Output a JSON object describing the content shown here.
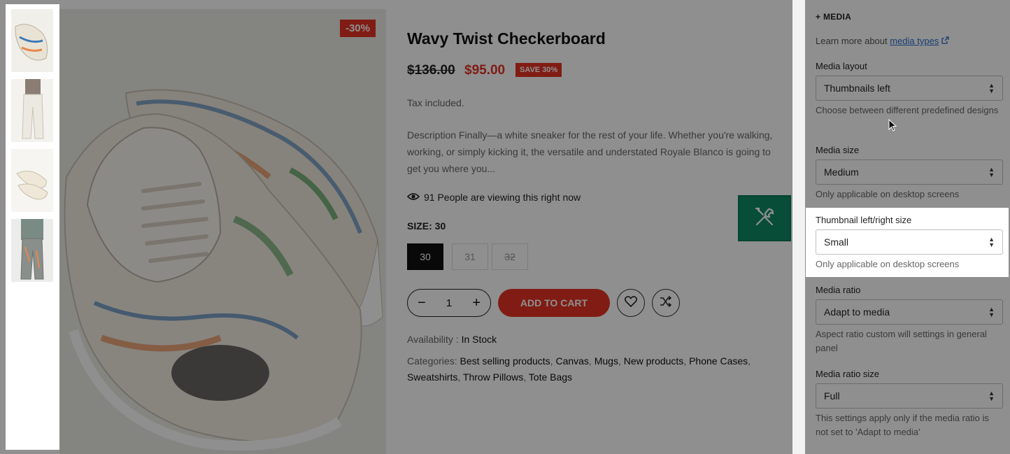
{
  "product": {
    "discount_badge": "-30%",
    "title": "Wavy Twist Checkerboard",
    "old_price": "$136.00",
    "new_price": "$95.00",
    "save_badge": "SAVE 30%",
    "tax": "Tax included.",
    "description": "Description Finally—a white sneaker for the rest of your life. Whether you're walking, working, or simply kicking it, the versatile and understated Royale Blanco is going to get you where you...",
    "viewing": "91 People are viewing this right now",
    "size_label": "SIZE: 30",
    "sizes": [
      "30",
      "31",
      "32"
    ],
    "quantity": "1",
    "add_to_cart": "ADD TO CART",
    "availability_label": "Availability :",
    "availability_value": "In Stock",
    "categories_label": "Categories:",
    "categories": [
      "Best selling products",
      "Canvas",
      "Mugs",
      "New products",
      "Phone Cases",
      "Sweatshirts",
      "Throw Pillows",
      "Tote Bags"
    ]
  },
  "panel": {
    "section_head": "+ MEDIA",
    "learn_prefix": "Learn more about",
    "learn_link": "media types",
    "media_layout": {
      "label": "Media layout",
      "value": "Thumbnails left",
      "help": "Choose between different predefined designs"
    },
    "media_size": {
      "label": "Media size",
      "value": "Medium",
      "help": "Only applicable on desktop screens"
    },
    "thumb_size": {
      "label": "Thumbnail left/right size",
      "value": "Small",
      "help": "Only applicable on desktop screens"
    },
    "media_ratio": {
      "label": "Media ratio",
      "value": "Adapt to media",
      "help": "Aspect ratio custom will settings in general panel"
    },
    "media_ratio_size": {
      "label": "Media ratio size",
      "value": "Full",
      "help": "This settings apply only if the media ratio is not set to 'Adapt to media'"
    }
  },
  "icons": {
    "tool": "wrench-screwdriver-icon",
    "eye": "eye-icon",
    "wishlist": "heart-icon",
    "compare": "shuffle-icon",
    "external": "external-link-icon"
  },
  "colors": {
    "accent_red": "#e53224",
    "tool_green": "#0d8a63",
    "link_blue": "#2c6ecb"
  }
}
